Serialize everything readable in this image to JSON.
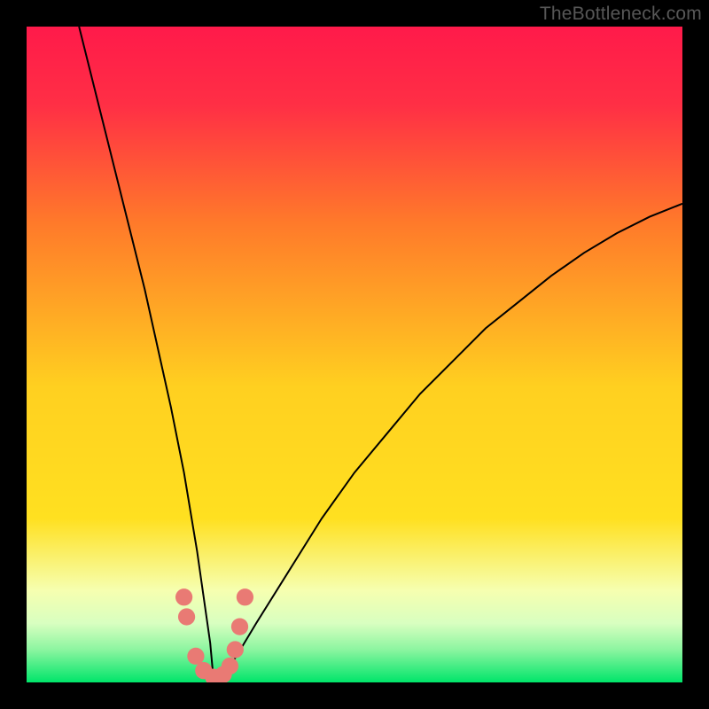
{
  "watermark": "TheBottleneck.com",
  "colors": {
    "background": "#000000",
    "gradient_top": "#ff1a4a",
    "gradient_mid1": "#ff7a2a",
    "gradient_mid2": "#ffe020",
    "gradient_low": "#f6ffb0",
    "gradient_bottom": "#00e56a",
    "curve": "#000000",
    "marker": "#e97a74"
  },
  "chart_data": {
    "type": "line",
    "title": "",
    "xlabel": "",
    "ylabel": "",
    "xlim": [
      0,
      100
    ],
    "ylim": [
      0,
      100
    ],
    "grid": false,
    "legend": false,
    "curve_minimum_x": 28.5,
    "series": [
      {
        "name": "bottleneck-curve",
        "x": [
          8,
          10,
          12,
          14,
          16,
          18,
          20,
          22,
          24,
          26,
          28,
          28.5,
          30,
          32,
          35,
          40,
          45,
          50,
          55,
          60,
          65,
          70,
          75,
          80,
          85,
          90,
          95,
          100
        ],
        "y": [
          100,
          92,
          84,
          76,
          68,
          60,
          51,
          42,
          32,
          20,
          6,
          0.5,
          1,
          4,
          9,
          17,
          25,
          32,
          38,
          44,
          49,
          54,
          58,
          62,
          65.5,
          68.5,
          71,
          73
        ]
      },
      {
        "name": "markers",
        "x": [
          24.0,
          24.4,
          25.8,
          27.0,
          28.5,
          30.0,
          31.0,
          31.8,
          32.5,
          33.3
        ],
        "y": [
          13.0,
          10.0,
          4.0,
          1.8,
          0.8,
          1.2,
          2.5,
          5.0,
          8.5,
          13.0
        ]
      }
    ]
  }
}
